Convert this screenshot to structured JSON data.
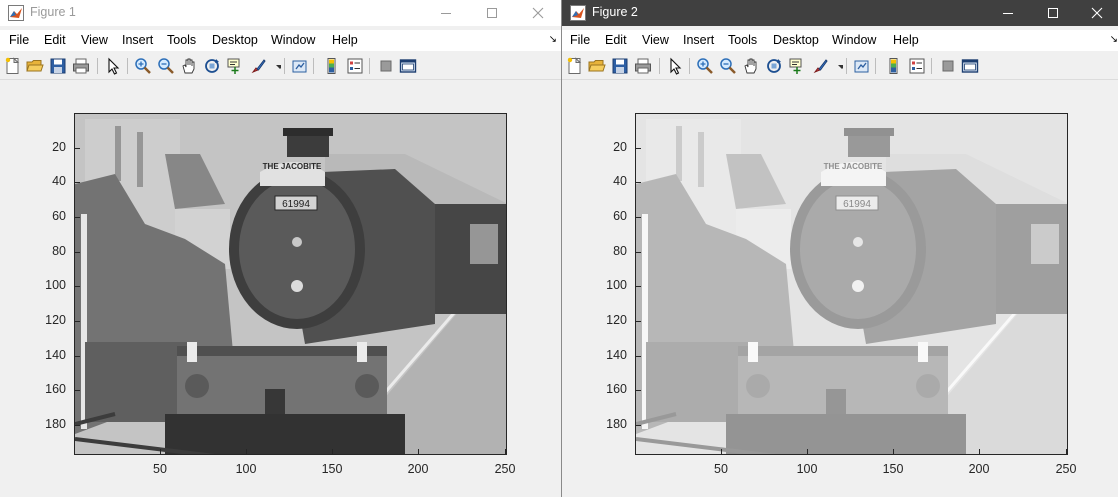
{
  "windows": [
    {
      "title": "Figure 1",
      "menus": [
        "File",
        "Edit",
        "View",
        "Insert",
        "Tools",
        "Desktop",
        "Window",
        "Help"
      ],
      "menu_overflow": "↘",
      "y_ticks": [
        "20",
        "40",
        "60",
        "80",
        "100",
        "120",
        "140",
        "160",
        "180"
      ],
      "x_ticks": [
        "50",
        "100",
        "150",
        "200",
        "250"
      ],
      "image": {
        "subject": "grayscale steam locomotive",
        "plate": "61994",
        "headboard": "THE JACOBITE",
        "contrast": "normal"
      }
    },
    {
      "title": "Figure 2",
      "menus": [
        "File",
        "Edit",
        "View",
        "Insert",
        "Tools",
        "Desktop",
        "Window",
        "Help"
      ],
      "menu_overflow": "↘",
      "y_ticks": [
        "20",
        "40",
        "60",
        "80",
        "100",
        "120",
        "140",
        "160",
        "180"
      ],
      "x_ticks": [
        "50",
        "100",
        "150",
        "200",
        "250"
      ],
      "image": {
        "subject": "grayscale steam locomotive, brightened",
        "plate": "61994",
        "headboard": "THE JACOBITE",
        "contrast": "brightened"
      }
    }
  ],
  "toolbar_icons": [
    "new-figure-icon",
    "open-file-icon",
    "save-icon",
    "print-icon",
    "pointer-icon",
    "zoom-in-icon",
    "zoom-out-icon",
    "pan-icon",
    "rotate-3d-icon",
    "data-cursor-icon",
    "brush-icon",
    "brush-dropdown-icon",
    "link-plot-icon",
    "colorbar-icon",
    "legend-icon",
    "hide-plot-tools-icon",
    "show-plot-tools-icon"
  ],
  "colors": {
    "window_bg": "#f0f0f0",
    "titlebar_active": "#404040",
    "titlebar_inactive": "#ffffff",
    "axis": "#262626"
  }
}
